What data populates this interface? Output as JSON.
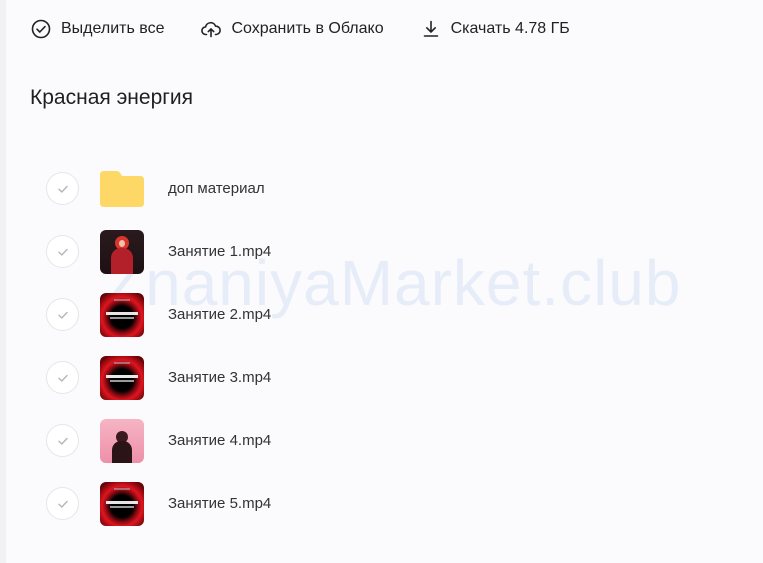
{
  "toolbar": {
    "select_all": "Выделить все",
    "save_cloud": "Сохранить в Облако",
    "download": "Скачать 4.78 ГБ"
  },
  "folder_title": "Красная энергия",
  "items": [
    {
      "name": "доп материал",
      "type": "folder"
    },
    {
      "name": "Занятие 1.mp4",
      "type": "video"
    },
    {
      "name": "Занятие 2.mp4",
      "type": "video"
    },
    {
      "name": "Занятие 3.mp4",
      "type": "video"
    },
    {
      "name": "Занятие 4.mp4",
      "type": "video"
    },
    {
      "name": "Занятие 5.mp4",
      "type": "video"
    }
  ],
  "watermark": "ZnaniyaMarket.club",
  "colors": {
    "folder": "#fdd866",
    "check": "#b5b5bb",
    "accent_red": "#e0151f"
  }
}
